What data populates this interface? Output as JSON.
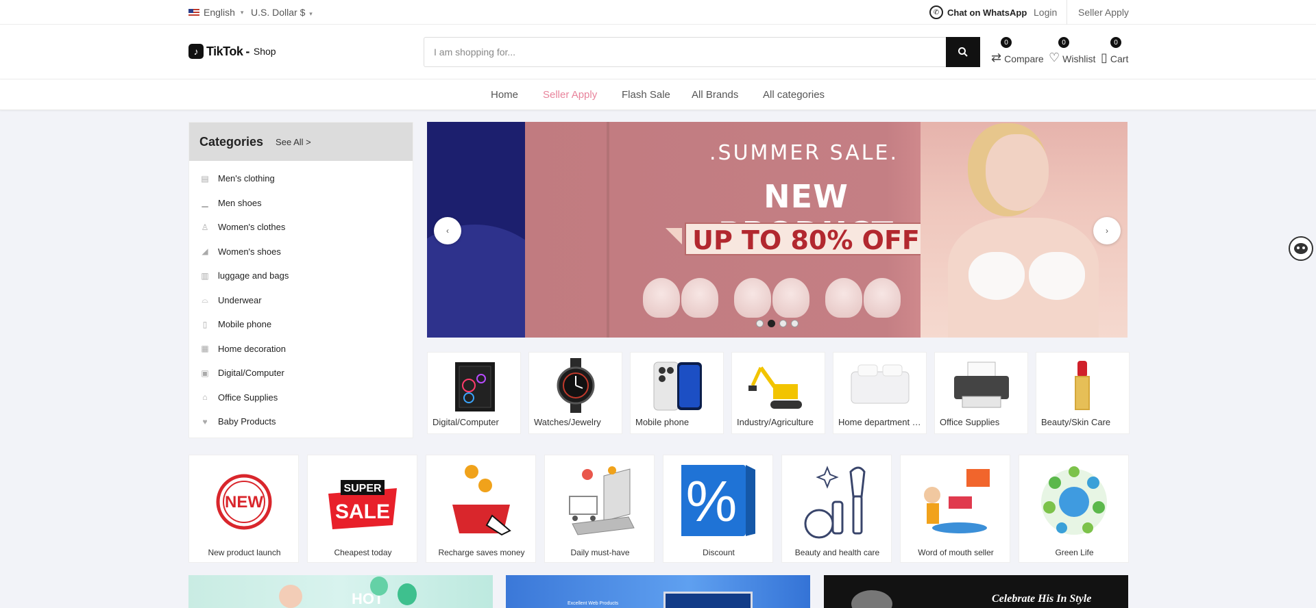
{
  "topbar": {
    "language": "English",
    "currency": "U.S. Dollar $",
    "whatsapp": "Chat on WhatsApp",
    "login": "Login",
    "seller_apply": "Seller Apply"
  },
  "header": {
    "logo_text": "TikTok",
    "logo_sub": "Shop",
    "search_placeholder": "I am shopping for...",
    "compare": {
      "label": "Compare",
      "count": "0"
    },
    "wishlist": {
      "label": "Wishlist",
      "count": "0"
    },
    "cart": {
      "label": "Cart",
      "count": "0"
    }
  },
  "nav": {
    "items": [
      {
        "label": "Home"
      },
      {
        "label": "Seller Apply"
      },
      {
        "label": "Flash Sale"
      },
      {
        "label": "All Brands"
      },
      {
        "label": "All categories"
      }
    ],
    "active": "Seller Apply"
  },
  "categories": {
    "title": "Categories",
    "see_all": "See All >",
    "items": [
      {
        "label": "Men's clothing",
        "icon": "shirt-icon"
      },
      {
        "label": "Men shoes",
        "icon": "shoe-icon"
      },
      {
        "label": "Women's clothes",
        "icon": "dress-icon"
      },
      {
        "label": "Women's shoes",
        "icon": "heel-icon"
      },
      {
        "label": "luggage and bags",
        "icon": "luggage-icon"
      },
      {
        "label": "Underwear",
        "icon": "underwear-icon"
      },
      {
        "label": "Mobile phone",
        "icon": "phone-icon"
      },
      {
        "label": "Home decoration",
        "icon": "home-decor-icon"
      },
      {
        "label": "Digital/Computer",
        "icon": "computer-icon"
      },
      {
        "label": "Office Supplies",
        "icon": "office-icon"
      },
      {
        "label": "Baby Products",
        "icon": "baby-icon"
      }
    ]
  },
  "banner": {
    "subtitle": ".SUMMER SALE.",
    "title": "NEW PRODUCT",
    "offer": "UP TO 80% OFF",
    "slides_total": 4,
    "active_slide": 2
  },
  "featured": [
    {
      "label": "Digital/Computer"
    },
    {
      "label": "Watches/Jewelry"
    },
    {
      "label": "Mobile phone"
    },
    {
      "label": "Industry/Agriculture"
    },
    {
      "label": "Home department store"
    },
    {
      "label": "Office Supplies"
    },
    {
      "label": "Beauty/Skin Care"
    }
  ],
  "features": [
    {
      "label": "New product launch",
      "art_text": "NEW"
    },
    {
      "label": "Cheapest today",
      "art_text_top": "SUPER",
      "art_text_bottom": "SALE"
    },
    {
      "label": "Recharge saves money"
    },
    {
      "label": "Daily must-have"
    },
    {
      "label": "Discount",
      "art_text": "%"
    },
    {
      "label": "Beauty and health care"
    },
    {
      "label": "Word of mouth seller"
    },
    {
      "label": "Green Life"
    }
  ],
  "bottom_banners": [
    {
      "text": "HOT"
    },
    {
      "text": "Excellent Web Products"
    },
    {
      "text": "Celebrate His In Style"
    }
  ],
  "colors": {
    "accent_pink": "#e8839b",
    "dark": "#111111",
    "page_bg": "#f2f3f8"
  }
}
